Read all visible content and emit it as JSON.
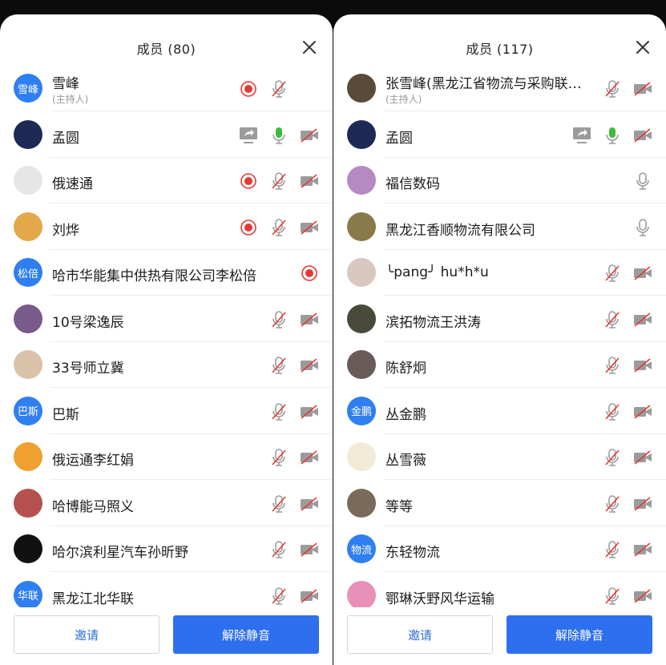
{
  "left_panel": {
    "title": "成员 (80)",
    "members": [
      {
        "name": "雪峰",
        "sub": "(主持人)",
        "avatar_text": "雪峰",
        "avatar_color": "#2f7ff0",
        "icons": [
          "record",
          "mic-muted"
        ]
      },
      {
        "name": "孟圆",
        "avatar_color": "#1d2a55",
        "icons": [
          "screen-share",
          "mic-active",
          "camera-off"
        ]
      },
      {
        "name": "俄速通",
        "avatar_color": "#e6e6e6",
        "icons": [
          "record",
          "mic-muted",
          "camera-off"
        ]
      },
      {
        "name": "刘烨",
        "avatar_color": "#e3a84a",
        "icons": [
          "record",
          "mic-muted",
          "camera-off"
        ]
      },
      {
        "name": "哈市华能集中供热有限公司李松倍",
        "avatar_text": "松倍",
        "avatar_color": "#2f7ff0",
        "icons": [
          "record"
        ]
      },
      {
        "name": "10号梁逸辰",
        "avatar_color": "#7a5a8a",
        "icons": [
          "mic-muted",
          "camera-off"
        ]
      },
      {
        "name": "33号师立冀",
        "avatar_color": "#d9c2a8",
        "icons": [
          "mic-muted",
          "camera-off"
        ]
      },
      {
        "name": "巴斯",
        "avatar_text": "巴斯",
        "avatar_color": "#2f7ff0",
        "icons": [
          "mic-muted",
          "camera-off"
        ]
      },
      {
        "name": "俄运通李红娟",
        "avatar_color": "#f0a030",
        "icons": [
          "mic-muted",
          "camera-off"
        ]
      },
      {
        "name": "哈博能马照义",
        "avatar_color": "#b45050",
        "icons": [
          "mic-muted",
          "camera-off"
        ]
      },
      {
        "name": "哈尔滨利星汽车孙昕野",
        "avatar_color": "#111111",
        "icons": [
          "mic-muted",
          "camera-off"
        ]
      },
      {
        "name": "黑龙江北华联",
        "avatar_text": "华联",
        "avatar_color": "#2f7ff0",
        "icons": [
          "mic-muted",
          "camera-off"
        ]
      }
    ],
    "invite_label": "邀请",
    "unmute_label": "解除静音"
  },
  "right_panel": {
    "title": "成员 (117)",
    "members": [
      {
        "name": "张雪峰(黑龙江省物流与采购联…",
        "sub": "(主持人)",
        "avatar_color": "#5a4a3a",
        "icons": [
          "mic-muted",
          "camera-off"
        ]
      },
      {
        "name": "孟圆",
        "avatar_color": "#1d2a55",
        "icons": [
          "screen-share",
          "mic-active",
          "camera-off"
        ]
      },
      {
        "name": "福信数码",
        "avatar_color": "#b58ac0",
        "icons": [
          "mic-plain"
        ]
      },
      {
        "name": "黑龙江香顺物流有限公司",
        "avatar_color": "#8a7a4a",
        "icons": [
          "mic-plain"
        ]
      },
      {
        "name": "╰pang╯ hu*h*u",
        "avatar_color": "#d8c8c0",
        "icons": [
          "mic-muted",
          "camera-off"
        ]
      },
      {
        "name": "滨拓物流王洪涛",
        "avatar_color": "#4a4a3a",
        "icons": [
          "mic-muted",
          "camera-off"
        ]
      },
      {
        "name": "陈舒炯",
        "avatar_color": "#6a5a5a",
        "icons": [
          "mic-muted",
          "camera-off"
        ]
      },
      {
        "name": "丛金鹏",
        "avatar_text": "金鹏",
        "avatar_color": "#2f7ff0",
        "icons": [
          "mic-muted",
          "camera-off"
        ]
      },
      {
        "name": "丛雪薇",
        "avatar_color": "#f3ead8",
        "icons": [
          "mic-muted",
          "camera-off"
        ]
      },
      {
        "name": "等等",
        "avatar_color": "#7a6a5a",
        "icons": [
          "mic-muted",
          "camera-off"
        ]
      },
      {
        "name": "东轻物流",
        "avatar_text": "物流",
        "avatar_color": "#2f7ff0",
        "icons": [
          "mic-muted",
          "camera-off"
        ]
      },
      {
        "name": "鄂琳沃野风华运输",
        "avatar_color": "#e890b8",
        "icons": [
          "mic-muted",
          "camera-off"
        ]
      }
    ],
    "invite_label": "邀请",
    "unmute_label": "解除静音"
  },
  "colors": {
    "accent": "#2e6ff0",
    "record_red": "#e53935",
    "mic_green": "#3dbb3d",
    "icon_gray": "#9b9b9b",
    "muted_slash_red": "#e53935"
  }
}
